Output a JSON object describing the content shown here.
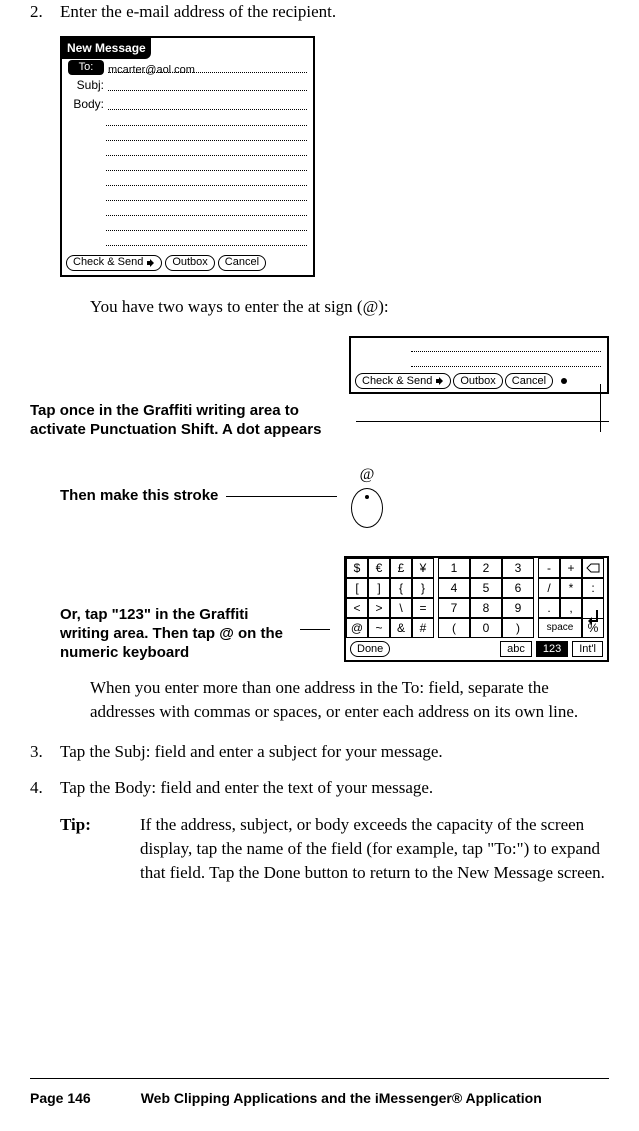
{
  "step2": {
    "num": "2.",
    "text": "Enter the e-mail address of the recipient."
  },
  "palmshot1": {
    "title": "New Message",
    "to_label": "To:",
    "to_value": "mcarter@aol.com",
    "subj_label": "Subj:",
    "body_label": "Body:",
    "btn_check": "Check & Send",
    "btn_outbox": "Outbox",
    "btn_cancel": "Cancel"
  },
  "para_at": "You have two ways to enter the at sign (@):",
  "callout1": "Tap once in the Graffiti writing area to activate Punctuation Shift. A dot appears",
  "palmshot2": {
    "btn_check": "Check & Send",
    "btn_outbox": "Outbox",
    "btn_cancel": "Cancel"
  },
  "callout2": "Then make this stroke",
  "stroke_at": "@",
  "callout3": "Or, tap \"123\" in the Graffiti writing area. Then tap @ on the numeric keyboard",
  "numkbd": {
    "row1_left": [
      "$",
      "€",
      "£",
      "¥"
    ],
    "row2_left": [
      "[",
      "]",
      "{",
      "}"
    ],
    "row3_left": [
      "<",
      ">",
      "\\",
      "="
    ],
    "row4_left": [
      "@",
      "~",
      "&",
      "#"
    ],
    "num_row1": [
      "1",
      "2",
      "3"
    ],
    "num_row2": [
      "4",
      "5",
      "6"
    ],
    "num_row3": [
      "7",
      "8",
      "9"
    ],
    "num_row4": [
      "(",
      "0",
      ")"
    ],
    "row1_right": [
      "-",
      "+"
    ],
    "row2_right": [
      "/",
      "*",
      ":"
    ],
    "row3_right": [
      ".",
      ","
    ],
    "space_label": "space",
    "percent": "%",
    "btn_done": "Done",
    "tab_abc": "abc",
    "tab_123": "123",
    "tab_intl": "Int'l"
  },
  "para_multi": "When you enter more than one address in the To: field, separate the addresses with commas or spaces, or enter each address on its own line.",
  "step3": {
    "num": "3.",
    "text": "Tap the Subj: field and enter a subject for your message."
  },
  "step4": {
    "num": "4.",
    "text": "Tap the Body: field and enter the text of your message."
  },
  "tip": {
    "label": "Tip:",
    "text": "If the address, subject, or body exceeds the capacity of the screen display, tap the name of the field (for example, tap \"To:\") to expand that field. Tap the Done button to return to the New Message screen."
  },
  "footer": {
    "page": "Page 146",
    "chapter": "Web Clipping Applications and the iMessenger® Application"
  }
}
